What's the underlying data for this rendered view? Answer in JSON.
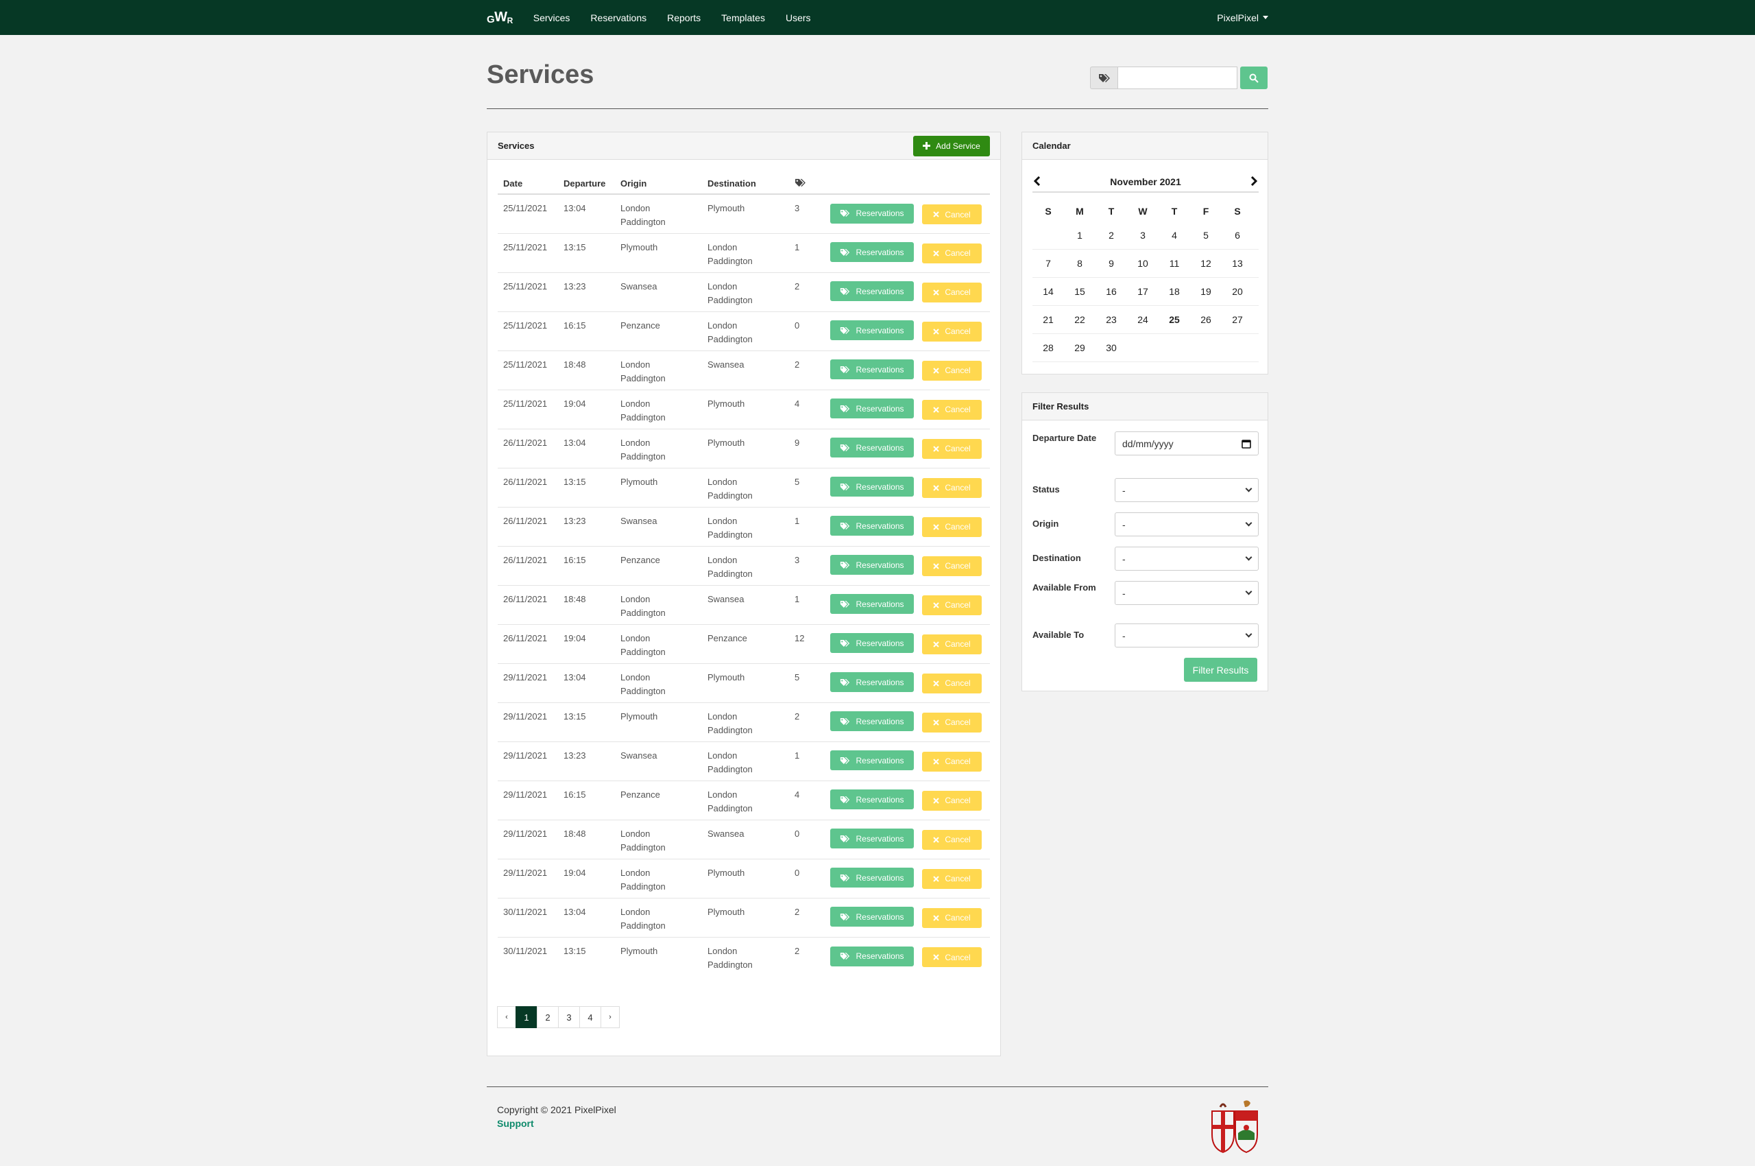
{
  "nav": {
    "brand": {
      "g": "G",
      "w": "W",
      "r": "R"
    },
    "links": [
      "Services",
      "Reservations",
      "Reports",
      "Templates",
      "Users"
    ],
    "user": "PixelPixel"
  },
  "header": {
    "title": "Services",
    "search_value": ""
  },
  "services": {
    "panel_title": "Services",
    "add_label": "Add Service",
    "columns": [
      "Date",
      "Departure",
      "Origin",
      "Destination"
    ],
    "reservations_label": "Reservations",
    "cancel_label": "Cancel",
    "rows": [
      {
        "date": "25/11/2021",
        "dep": "13:04",
        "origin": "London Paddington",
        "dest": "Plymouth",
        "count": "3"
      },
      {
        "date": "25/11/2021",
        "dep": "13:15",
        "origin": "Plymouth",
        "dest": "London Paddington",
        "count": "1"
      },
      {
        "date": "25/11/2021",
        "dep": "13:23",
        "origin": "Swansea",
        "dest": "London Paddington",
        "count": "2"
      },
      {
        "date": "25/11/2021",
        "dep": "16:15",
        "origin": "Penzance",
        "dest": "London Paddington",
        "count": "0"
      },
      {
        "date": "25/11/2021",
        "dep": "18:48",
        "origin": "London Paddington",
        "dest": "Swansea",
        "count": "2"
      },
      {
        "date": "25/11/2021",
        "dep": "19:04",
        "origin": "London Paddington",
        "dest": "Plymouth",
        "count": "4"
      },
      {
        "date": "26/11/2021",
        "dep": "13:04",
        "origin": "London Paddington",
        "dest": "Plymouth",
        "count": "9"
      },
      {
        "date": "26/11/2021",
        "dep": "13:15",
        "origin": "Plymouth",
        "dest": "London Paddington",
        "count": "5"
      },
      {
        "date": "26/11/2021",
        "dep": "13:23",
        "origin": "Swansea",
        "dest": "London Paddington",
        "count": "1"
      },
      {
        "date": "26/11/2021",
        "dep": "16:15",
        "origin": "Penzance",
        "dest": "London Paddington",
        "count": "3"
      },
      {
        "date": "26/11/2021",
        "dep": "18:48",
        "origin": "London Paddington",
        "dest": "Swansea",
        "count": "1"
      },
      {
        "date": "26/11/2021",
        "dep": "19:04",
        "origin": "London Paddington",
        "dest": "Penzance",
        "count": "12"
      },
      {
        "date": "29/11/2021",
        "dep": "13:04",
        "origin": "London Paddington",
        "dest": "Plymouth",
        "count": "5"
      },
      {
        "date": "29/11/2021",
        "dep": "13:15",
        "origin": "Plymouth",
        "dest": "London Paddington",
        "count": "2"
      },
      {
        "date": "29/11/2021",
        "dep": "13:23",
        "origin": "Swansea",
        "dest": "London Paddington",
        "count": "1"
      },
      {
        "date": "29/11/2021",
        "dep": "16:15",
        "origin": "Penzance",
        "dest": "London Paddington",
        "count": "4"
      },
      {
        "date": "29/11/2021",
        "dep": "18:48",
        "origin": "London Paddington",
        "dest": "Swansea",
        "count": "0"
      },
      {
        "date": "29/11/2021",
        "dep": "19:04",
        "origin": "London Paddington",
        "dest": "Plymouth",
        "count": "0"
      },
      {
        "date": "30/11/2021",
        "dep": "13:04",
        "origin": "London Paddington",
        "dest": "Plymouth",
        "count": "2"
      },
      {
        "date": "30/11/2021",
        "dep": "13:15",
        "origin": "Plymouth",
        "dest": "London Paddington",
        "count": "2"
      }
    ],
    "pagination": {
      "prev": "‹",
      "pages": [
        "1",
        "2",
        "3",
        "4"
      ],
      "active": "1",
      "next": "›"
    }
  },
  "calendar": {
    "panel_title": "Calendar",
    "month_label": "November 2021",
    "weekdays": [
      "S",
      "M",
      "T",
      "W",
      "T",
      "F",
      "S"
    ],
    "weeks": [
      [
        "",
        "1",
        "2",
        "3",
        "4",
        "5",
        "6"
      ],
      [
        "7",
        "8",
        "9",
        "10",
        "11",
        "12",
        "13"
      ],
      [
        "14",
        "15",
        "16",
        "17",
        "18",
        "19",
        "20"
      ],
      [
        "21",
        "22",
        "23",
        "24",
        "25",
        "26",
        "27"
      ],
      [
        "28",
        "29",
        "30",
        "",
        "",
        "",
        ""
      ]
    ],
    "today": "25"
  },
  "filter": {
    "panel_title": "Filter Results",
    "departure_label": "Departure Date",
    "departure_placeholder": "dd/mm/yyyy",
    "status_label": "Status",
    "status_value": "-",
    "origin_label": "Origin",
    "origin_value": "-",
    "destination_label": "Destination",
    "destination_value": "-",
    "available_from_label": "Available From",
    "available_from_value": "-",
    "available_to_label": "Available To",
    "available_to_value": "-",
    "submit_label": "Filter Results"
  },
  "footer": {
    "copyright": "Copyright © 2021 PixelPixel",
    "support": "Support"
  },
  "colors": {
    "navbar": "#063825",
    "primary_green": "#2f8a12",
    "success": "#5ec58e",
    "warning": "#ffd84f",
    "link": "#0e8a6b"
  },
  "icons": {
    "tags": "tags-icon",
    "search": "search-icon",
    "plus": "plus-icon",
    "times": "times-icon",
    "calendar": "calendar-icon",
    "chevron_left": "chevron-left-icon",
    "chevron_right": "chevron-right-icon"
  }
}
